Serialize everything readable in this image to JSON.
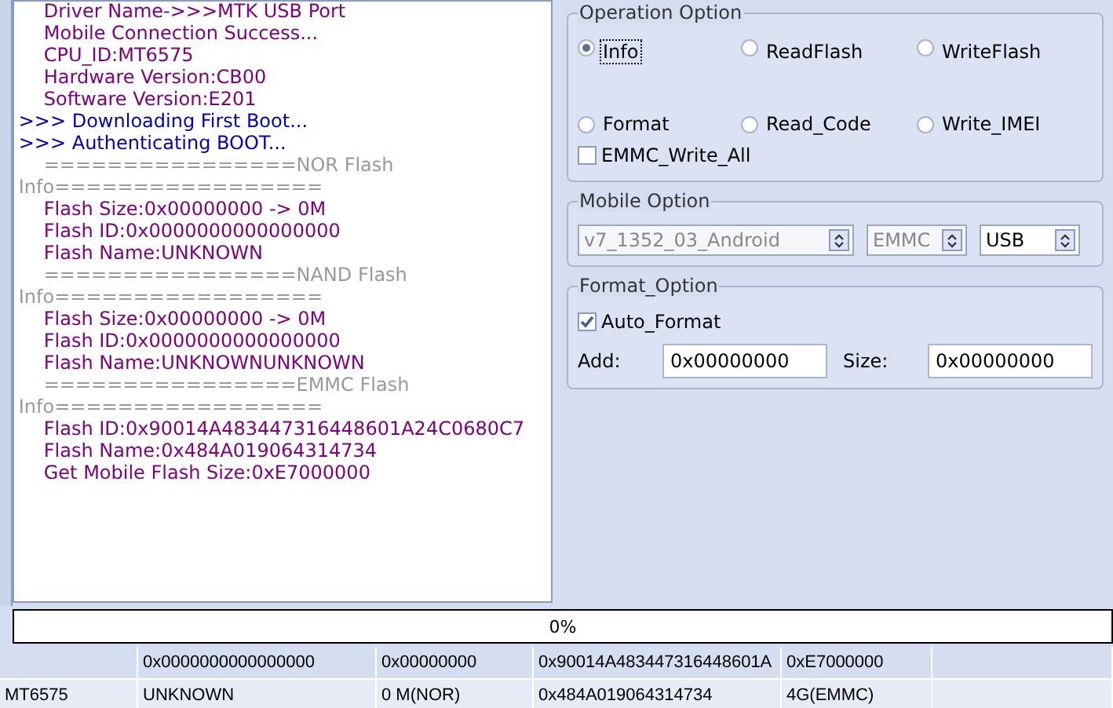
{
  "log": [
    {
      "kind": "info",
      "text": "Driver Name->>>MTK USB Port"
    },
    {
      "kind": "info",
      "text": "Mobile Connection Success..."
    },
    {
      "kind": "info",
      "text": "CPU_ID:MT6575"
    },
    {
      "kind": "info",
      "text": "Hardware Version:CB00"
    },
    {
      "kind": "info",
      "text": "Software Version:E201"
    },
    {
      "kind": "status",
      "text": ">>> Downloading First Boot..."
    },
    {
      "kind": "status",
      "text": ">>> Authenticating BOOT..."
    },
    {
      "kind": "separator",
      "text": "================NOR Flash Info================="
    },
    {
      "kind": "info",
      "text": "Flash Size:0x00000000 -> 0M"
    },
    {
      "kind": "info",
      "text": "Flash ID:0x0000000000000000"
    },
    {
      "kind": "info",
      "text": "Flash Name:UNKNOWN"
    },
    {
      "kind": "separator",
      "text": "================NAND Flash Info================="
    },
    {
      "kind": "info",
      "text": "Flash Size:0x00000000 -> 0M"
    },
    {
      "kind": "info",
      "text": "Flash ID:0x0000000000000000"
    },
    {
      "kind": "info",
      "text": "Flash Name:UNKNOWNUNKNOWN"
    },
    {
      "kind": "separator",
      "text": "================EMMC Flash Info================="
    },
    {
      "kind": "info",
      "text": "Flash ID:0x90014A483447316448601A24C0680C7"
    },
    {
      "kind": "info",
      "text": "Flash Name:0x484A019064314734"
    },
    {
      "kind": "info",
      "text": "Get Mobile Flash Size:0xE7000000"
    }
  ],
  "operation_option": {
    "title": "Operation Option",
    "options": [
      {
        "label": "Info",
        "selected": true
      },
      {
        "label": "ReadFlash",
        "selected": false
      },
      {
        "label": "WriteFlash",
        "selected": false
      },
      {
        "label": "Format",
        "selected": false
      },
      {
        "label": "Read_Code",
        "selected": false
      },
      {
        "label": "Write_IMEI",
        "selected": false
      }
    ],
    "emmc_write_all": {
      "label": "EMMC_Write_All",
      "checked": false
    }
  },
  "mobile_option": {
    "title": "Mobile Option",
    "dropdowns": [
      {
        "value": "v7_1352_03_Android",
        "disabled": true
      },
      {
        "value": "EMMC",
        "disabled": true
      },
      {
        "value": "USB",
        "disabled": false
      }
    ]
  },
  "format_option": {
    "title": "Format_Option",
    "auto_format": {
      "label": "Auto_Format",
      "checked": true
    },
    "add": {
      "label": "Add:",
      "value": "0x00000000"
    },
    "size": {
      "label": "Size:",
      "value": "0x00000000"
    }
  },
  "progress": {
    "text": "0%",
    "level": 0
  },
  "table": {
    "rows": [
      {
        "column_2": "0x0000000000000000",
        "column_3": "0x00000000",
        "column_4": "0x90014A483447316448601A",
        "column_5": "0xE7000000"
      },
      {
        "column_1": "MT6575",
        "column_2": "UNKNOWN",
        "column_3": "0 M(NOR)",
        "column_4": "0x484A019064314734",
        "column_5": "4G(EMMC)"
      }
    ]
  }
}
